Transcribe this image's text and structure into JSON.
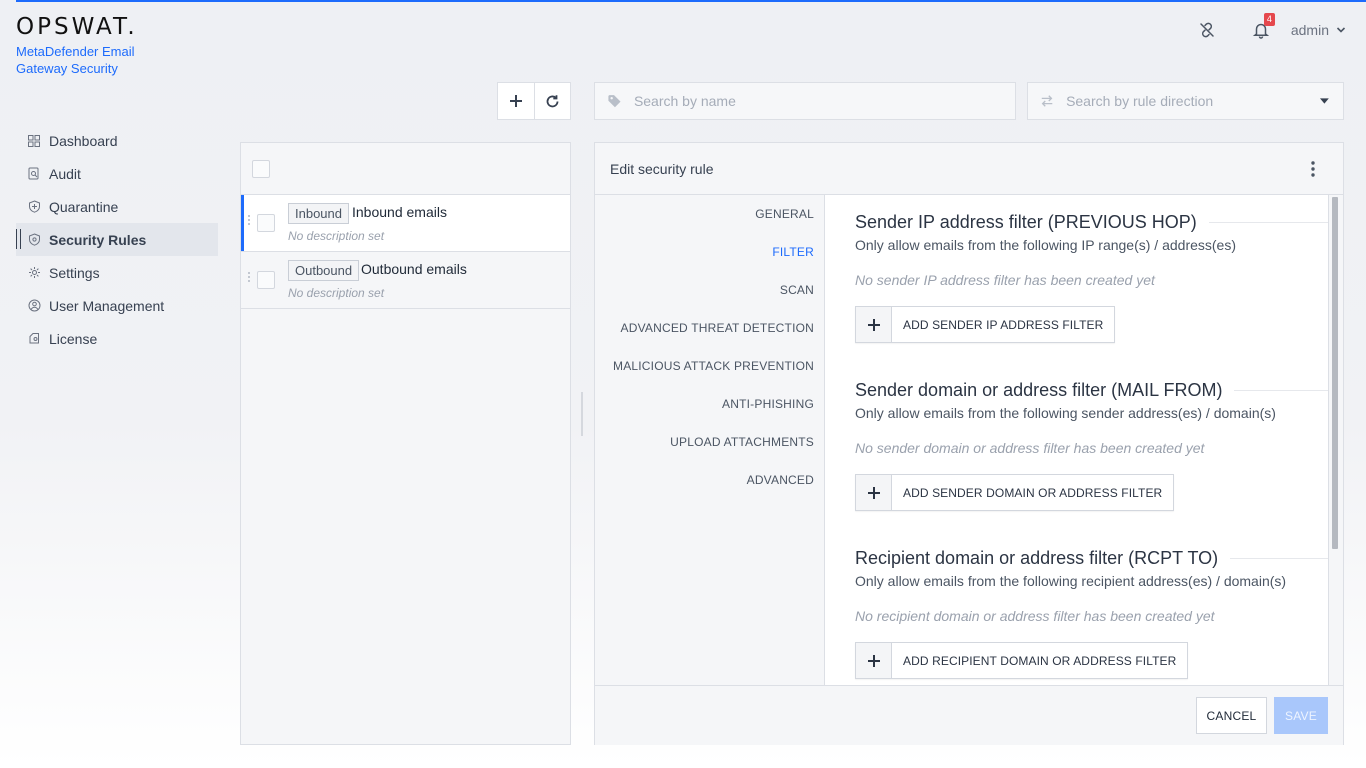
{
  "brand": {
    "logo": "OPSWAT.",
    "product": "MetaDefender Email Gateway Security",
    "accent": "#1d6bfc"
  },
  "topbar": {
    "notification_count": "4",
    "user": "admin"
  },
  "sidebar": {
    "items": [
      {
        "label": "Dashboard",
        "icon": "dashboard-icon"
      },
      {
        "label": "Audit",
        "icon": "audit-icon"
      },
      {
        "label": "Quarantine",
        "icon": "quarantine-icon"
      },
      {
        "label": "Security Rules",
        "icon": "shield-icon",
        "active": true
      },
      {
        "label": "Settings",
        "icon": "gear-icon"
      },
      {
        "label": "User Management",
        "icon": "user-icon"
      },
      {
        "label": "License",
        "icon": "license-icon"
      }
    ]
  },
  "toolbar": {
    "search_placeholder": "Search by name",
    "direction_placeholder": "Search by rule direction"
  },
  "rules": [
    {
      "tag": "Inbound",
      "name": "Inbound emails",
      "description": "No description set",
      "selected": true
    },
    {
      "tag": "Outbound",
      "name": "Outbound emails",
      "description": "No description set",
      "selected": false
    }
  ],
  "editor": {
    "title": "Edit security rule",
    "tabs": [
      "GENERAL",
      "FILTER",
      "SCAN",
      "ADVANCED THREAT DETECTION",
      "MALICIOUS ATTACK PREVENTION",
      "ANTI-PHISHING",
      "UPLOAD ATTACHMENTS",
      "ADVANCED"
    ],
    "active_tab": "FILTER",
    "sections": [
      {
        "title": "Sender IP address filter (PREVIOUS HOP)",
        "subtitle": "Only allow emails from the following IP range(s) / address(es)",
        "empty": "No sender IP address filter has been created yet",
        "button": "ADD SENDER IP ADDRESS FILTER"
      },
      {
        "title": "Sender domain or address filter (MAIL FROM)",
        "subtitle": "Only allow emails from the following sender address(es) / domain(s)",
        "empty": "No sender domain or address filter has been created yet",
        "button": "ADD SENDER DOMAIN OR ADDRESS FILTER"
      },
      {
        "title": "Recipient domain or address filter (RCPT TO)",
        "subtitle": "Only allow emails from the following recipient address(es) / domain(s)",
        "empty": "No recipient domain or address filter has been created yet",
        "button": "ADD RECIPIENT DOMAIN OR ADDRESS FILTER"
      }
    ],
    "cancel": "CANCEL",
    "save": "SAVE"
  }
}
